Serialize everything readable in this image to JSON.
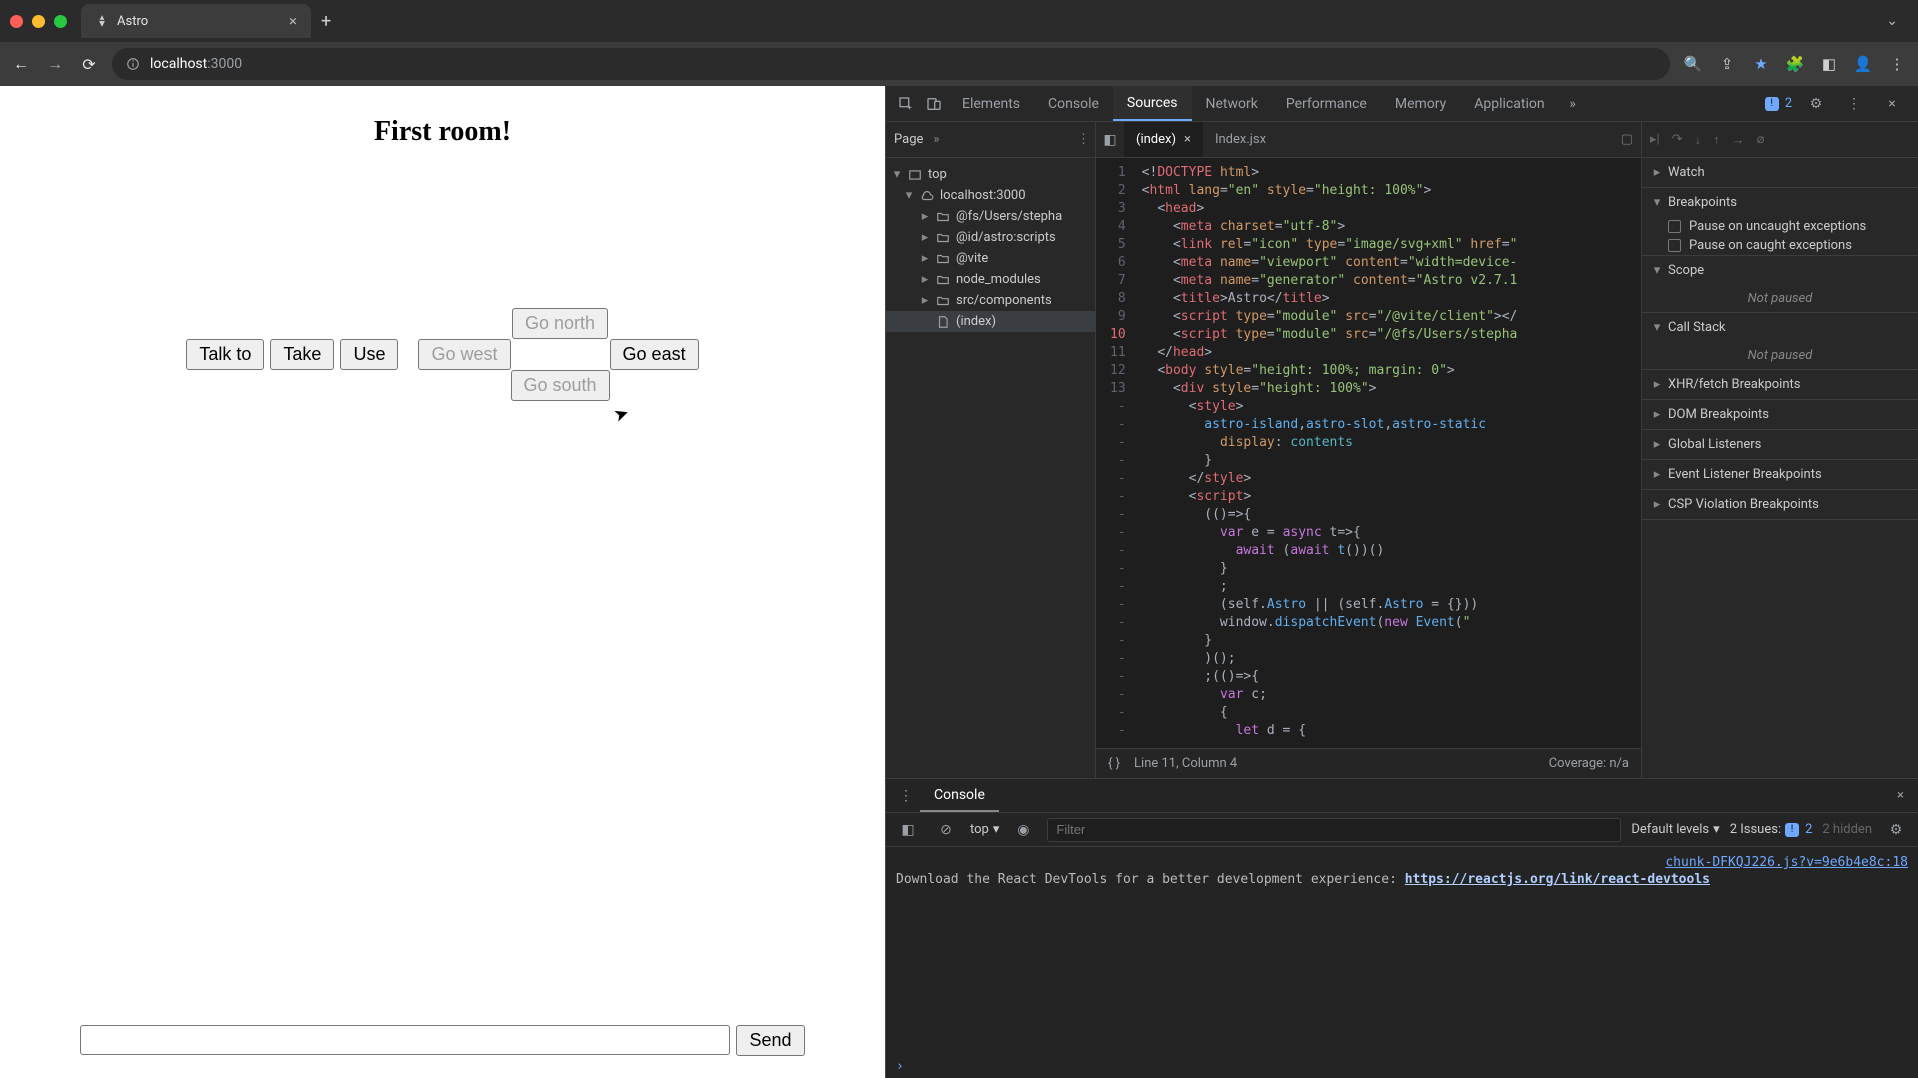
{
  "browser": {
    "tab_title": "Astro",
    "url_host": "localhost",
    "url_port": ":3000"
  },
  "game": {
    "title": "First room!",
    "actions": {
      "talk": "Talk to",
      "take": "Take",
      "use": "Use"
    },
    "nav": {
      "north": "Go north",
      "west": "Go west",
      "east": "Go east",
      "south": "Go south"
    },
    "send": "Send"
  },
  "devtools": {
    "tabs": {
      "elements": "Elements",
      "console": "Console",
      "sources": "Sources",
      "network": "Network",
      "performance": "Performance",
      "memory": "Memory",
      "application": "Application"
    },
    "issues_count": "2",
    "nav_header": "Page",
    "tree": {
      "top": "top",
      "host": "localhost:3000",
      "f1": "@fs/Users/stepha",
      "f2": "@id/astro:scripts",
      "f3": "@vite",
      "f4": "node_modules",
      "f5": "src/components",
      "file_index": "(index)"
    },
    "editor_tabs": {
      "index": "(index)",
      "indexjsx": "Index.jsx"
    },
    "code_lines": [
      {
        "n": "1",
        "html": "<span class='tok-punc'>&lt;!</span><span class='tok-tag'>DOCTYPE</span> <span class='tok-attr'>html</span><span class='tok-punc'>&gt;</span>"
      },
      {
        "n": "2",
        "html": "<span class='tok-punc'>&lt;</span><span class='tok-tag'>html</span> <span class='tok-attr'>lang</span>=<span class='tok-str'>\"en\"</span> <span class='tok-attr'>style</span>=<span class='tok-str'>\"height: 100%\"</span><span class='tok-punc'>&gt;</span>"
      },
      {
        "n": "3",
        "html": "  <span class='tok-punc'>&lt;</span><span class='tok-tag'>head</span><span class='tok-punc'>&gt;</span>"
      },
      {
        "n": "4",
        "html": "    <span class='tok-punc'>&lt;</span><span class='tok-tag'>meta</span> <span class='tok-attr'>charset</span>=<span class='tok-str'>\"utf-8\"</span><span class='tok-punc'>&gt;</span>"
      },
      {
        "n": "5",
        "html": "    <span class='tok-punc'>&lt;</span><span class='tok-tag'>link</span> <span class='tok-attr'>rel</span>=<span class='tok-str'>\"icon\"</span> <span class='tok-attr'>type</span>=<span class='tok-str'>\"image/svg+xml\"</span> <span class='tok-attr'>href</span>=<span class='tok-str'>\"</span>"
      },
      {
        "n": "6",
        "html": "    <span class='tok-punc'>&lt;</span><span class='tok-tag'>meta</span> <span class='tok-attr'>name</span>=<span class='tok-str'>\"viewport\"</span> <span class='tok-attr'>content</span>=<span class='tok-str'>\"width=device-</span>"
      },
      {
        "n": "7",
        "html": "    <span class='tok-punc'>&lt;</span><span class='tok-tag'>meta</span> <span class='tok-attr'>name</span>=<span class='tok-str'>\"generator\"</span> <span class='tok-attr'>content</span>=<span class='tok-str'>\"Astro v2.7.1</span>"
      },
      {
        "n": "8",
        "html": "    <span class='tok-punc'>&lt;</span><span class='tok-tag'>title</span><span class='tok-punc'>&gt;</span>Astro<span class='tok-punc'>&lt;/</span><span class='tok-tag'>title</span><span class='tok-punc'>&gt;</span>"
      },
      {
        "n": "9",
        "html": "    <span class='tok-punc'>&lt;</span><span class='tok-tag'>script</span> <span class='tok-attr'>type</span>=<span class='tok-str'>\"module\"</span> <span class='tok-attr'>src</span>=<span class='tok-str'>\"/@vite/client\"</span><span class='tok-punc'>&gt;&lt;/</span>"
      },
      {
        "n": "10",
        "hl": true,
        "html": "    <span class='tok-punc'>&lt;</span><span class='tok-tag'>script</span> <span class='tok-attr'>type</span>=<span class='tok-str'>\"module\"</span> <span class='tok-attr'>src</span>=<span class='tok-str'>\"/@fs/Users/stepha</span>"
      },
      {
        "n": "11",
        "html": "  <span class='tok-punc'>&lt;/</span><span class='tok-tag'>head</span><span class='tok-punc'>&gt;</span>"
      },
      {
        "n": "12",
        "html": "  <span class='tok-punc'>&lt;</span><span class='tok-tag'>body</span> <span class='tok-attr'>style</span>=<span class='tok-str'>\"height: 100%; margin: 0\"</span><span class='tok-punc'>&gt;</span>"
      },
      {
        "n": "13",
        "html": "    <span class='tok-punc'>&lt;</span><span class='tok-tag'>div</span> <span class='tok-attr'>style</span>=<span class='tok-str'>\"height: 100%\"</span><span class='tok-punc'>&gt;</span>"
      },
      {
        "n": "-",
        "html": "      <span class='tok-punc'>&lt;</span><span class='tok-tag'>style</span><span class='tok-punc'>&gt;</span>"
      },
      {
        "n": "-",
        "html": "        <span class='tok-id'>astro-island</span><span class='tok-punc'>,</span><span class='tok-id'>astro-slot</span><span class='tok-punc'>,</span><span class='tok-id'>astro-static</span>"
      },
      {
        "n": "-",
        "html": "          <span class='tok-attr'>display</span>: <span class='tok-const'>contents</span>"
      },
      {
        "n": "-",
        "html": "        }"
      },
      {
        "n": "-",
        "html": "      <span class='tok-punc'>&lt;/</span><span class='tok-tag'>style</span><span class='tok-punc'>&gt;</span>"
      },
      {
        "n": "-",
        "html": "      <span class='tok-punc'>&lt;</span><span class='tok-tag'>script</span><span class='tok-punc'>&gt;</span>"
      },
      {
        "n": "-",
        "html": "        (()=&gt;{"
      },
      {
        "n": "-",
        "html": "          <span class='tok-kw'>var</span> e = <span class='tok-kw'>async</span> t=&gt;{"
      },
      {
        "n": "-",
        "html": "            <span class='tok-kw'>await</span> (<span class='tok-kw'>await</span> <span class='tok-fn'>t</span>())()"
      },
      {
        "n": "-",
        "html": "          }"
      },
      {
        "n": "-",
        "html": "          ;"
      },
      {
        "n": "-",
        "html": "          (self.<span class='tok-id'>Astro</span> || (self.<span class='tok-id'>Astro</span> = {}))"
      },
      {
        "n": "-",
        "html": "          window.<span class='tok-fn'>dispatchEvent</span>(<span class='tok-kw'>new</span> <span class='tok-fn'>Event</span>(<span class='tok-str'>\"</span>"
      },
      {
        "n": "-",
        "html": "        }"
      },
      {
        "n": "-",
        "html": "        )();"
      },
      {
        "n": "-",
        "html": "        ;(()=&gt;{"
      },
      {
        "n": "-",
        "html": "          <span class='tok-kw'>var</span> c;"
      },
      {
        "n": "-",
        "html": "          {"
      },
      {
        "n": "-",
        "html": "            <span class='tok-kw'>let</span> d = {"
      }
    ],
    "status": {
      "pos": "Line 11, Column 4",
      "coverage": "Coverage: n/a"
    },
    "sidebar": {
      "watch": "Watch",
      "breakpoints": "Breakpoints",
      "bp_uncaught": "Pause on uncaught exceptions",
      "bp_caught": "Pause on caught exceptions",
      "scope": "Scope",
      "not_paused": "Not paused",
      "callstack": "Call Stack",
      "xhr": "XHR/fetch Breakpoints",
      "dom": "DOM Breakpoints",
      "global": "Global Listeners",
      "evt": "Event Listener Breakpoints",
      "csp": "CSP Violation Breakpoints"
    }
  },
  "console": {
    "drawer_title": "Console",
    "context": "top",
    "filter_placeholder": "Filter",
    "levels": "Default levels",
    "issues_label": "2 Issues:",
    "issues_count": "2",
    "hidden": "2 hidden",
    "log_src": "chunk-DFKQJ226.js?v=9e6b4e8c:18",
    "log_msg": "Download the React DevTools for a better development experience: ",
    "log_link": "https://reactjs.org/link/react-devtools"
  }
}
